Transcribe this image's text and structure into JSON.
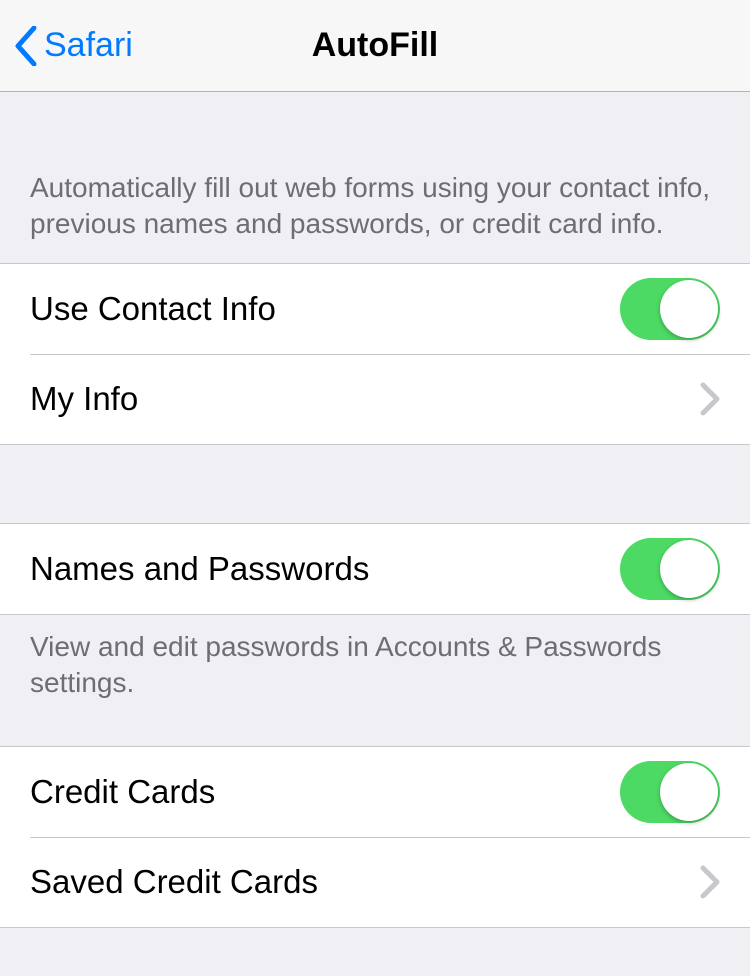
{
  "navbar": {
    "back_label": "Safari",
    "title": "AutoFill"
  },
  "intro_text": "Automatically fill out web forms using your contact info, previous names and passwords, or credit card info.",
  "contact_section": {
    "toggle_label": "Use Contact Info",
    "toggle_on": true,
    "nav_label": "My Info"
  },
  "passwords_section": {
    "toggle_label": "Names and Passwords",
    "toggle_on": true,
    "footer_text": "View and edit passwords in Accounts & Passwords settings."
  },
  "credit_cards_section": {
    "toggle_label": "Credit Cards",
    "toggle_on": true,
    "nav_label": "Saved Credit Cards"
  }
}
